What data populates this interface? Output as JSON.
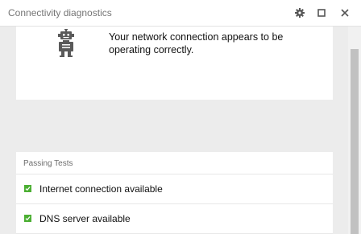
{
  "window": {
    "title": "Connectivity diagnostics"
  },
  "status": {
    "icon": "robot-icon",
    "message": "Your network connection appears to be operating correctly."
  },
  "tests": {
    "header": "Passing Tests",
    "items": [
      {
        "label": "Internet connection available",
        "status": "pass"
      },
      {
        "label": "DNS server available",
        "status": "pass"
      }
    ]
  },
  "colors": {
    "pass": "#4caf33",
    "icon": "#5a5a5a"
  }
}
